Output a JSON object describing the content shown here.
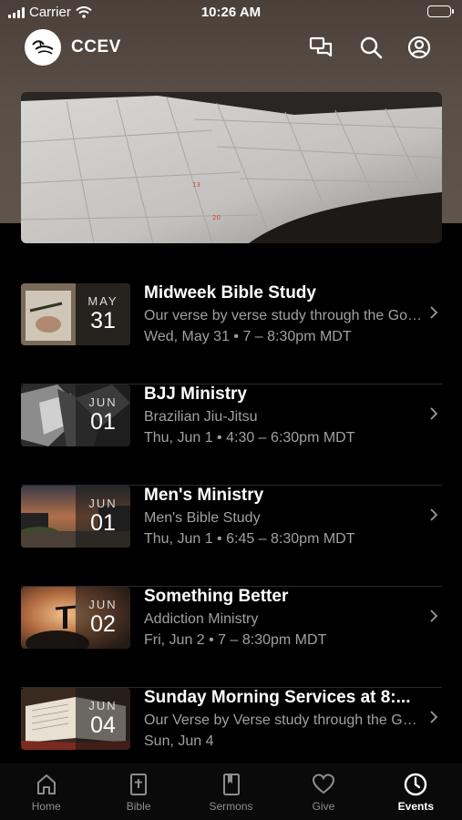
{
  "status_bar": {
    "carrier": "Carrier",
    "time": "10:26 AM"
  },
  "app": {
    "title": "CCEV",
    "logo_icon": "ccev-logo-icon"
  },
  "header_icons": [
    "chat-icon",
    "search-icon",
    "profile-icon"
  ],
  "events": [
    {
      "month": "MAY",
      "day": "31",
      "title": "Midweek Bible Study",
      "subtitle": "Our verse by verse study through the Gospel of John",
      "time": "Wed, May 31 • 7 – 8:30pm MDT"
    },
    {
      "month": "JUN",
      "day": "01",
      "title": "BJJ Ministry",
      "subtitle": "Brazilian Jiu-Jitsu",
      "time": "Thu, Jun 1 • 4:30 – 6:30pm MDT"
    },
    {
      "month": "JUN",
      "day": "01",
      "title": "Men's Ministry",
      "subtitle": "Men's Bible Study",
      "time": "Thu, Jun 1 • 6:45 – 8:30pm MDT"
    },
    {
      "month": "JUN",
      "day": "02",
      "title": "Something Better",
      "subtitle": "Addiction Ministry",
      "time": "Fri, Jun 2 • 7 – 8:30pm MDT"
    },
    {
      "month": "JUN",
      "day": "04",
      "title": "Sunday Morning Services at 8:...",
      "subtitle": "Our Verse by Verse study through the Gospel",
      "time": "Sun, Jun 4"
    }
  ],
  "tabs": [
    {
      "label": "Home",
      "icon": "home-icon",
      "active": false
    },
    {
      "label": "Bible",
      "icon": "bible-icon",
      "active": false
    },
    {
      "label": "Sermons",
      "icon": "sermons-icon",
      "active": false
    },
    {
      "label": "Give",
      "icon": "heart-icon",
      "active": false
    },
    {
      "label": "Events",
      "icon": "clock-icon",
      "active": true
    }
  ]
}
